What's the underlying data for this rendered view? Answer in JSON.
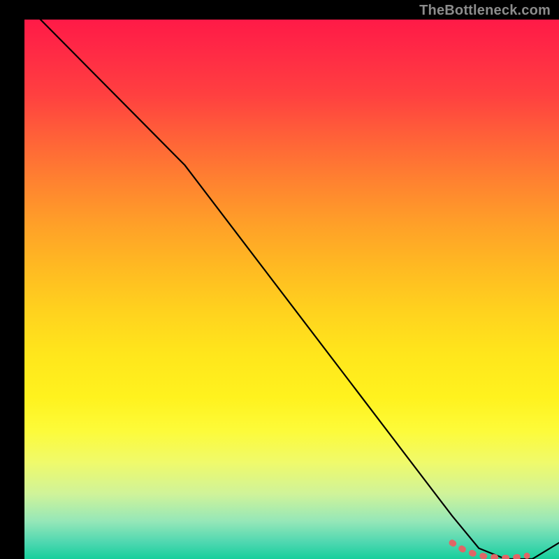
{
  "watermark": "TheBottleneck.com",
  "colors": {
    "line": "#000000",
    "marker": "#e06666",
    "gradient_top": "#ff1a47",
    "gradient_bottom": "#17cf9c",
    "page_bg": "#000000"
  },
  "chart_data": {
    "type": "line",
    "title": "",
    "xlabel": "",
    "ylabel": "",
    "xlim": [
      0,
      100
    ],
    "ylim": [
      0,
      100
    ],
    "grid": false,
    "legend": false,
    "series": [
      {
        "name": "curve",
        "x": [
          0,
          10,
          20,
          30,
          40,
          50,
          60,
          70,
          80,
          85,
          90,
          95,
          100
        ],
        "y": [
          103,
          93,
          83,
          73,
          60,
          47,
          34,
          21,
          8,
          2,
          0,
          0,
          3
        ]
      }
    ],
    "markers": {
      "name": "highlight-segment",
      "x": [
        80,
        82,
        84,
        86,
        88,
        90,
        92,
        94
      ],
      "y": [
        3.0,
        1.8,
        1.0,
        0.5,
        0.3,
        0.2,
        0.3,
        0.6
      ]
    }
  }
}
